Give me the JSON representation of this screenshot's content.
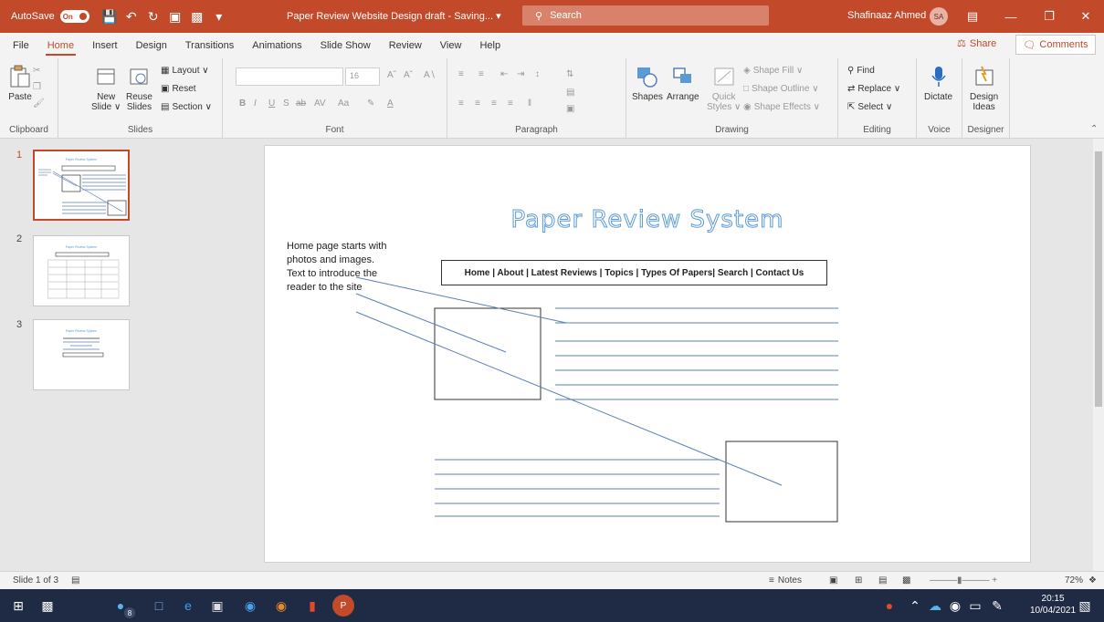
{
  "titlebar": {
    "autosave_label": "AutoSave",
    "autosave_state": "On",
    "document_title": "Paper Review Website Design draft - Saving... ▾",
    "search_placeholder": "Search",
    "user_name": "Shafinaaz Ahmed",
    "user_initials": "SA",
    "accent_color": "#c24a2b"
  },
  "tabs": [
    "File",
    "Home",
    "Insert",
    "Design",
    "Transitions",
    "Animations",
    "Slide Show",
    "Review",
    "View",
    "Help"
  ],
  "active_tab": "Home",
  "share_label": "Share",
  "comments_label": "Comments",
  "ribbon": {
    "clipboard": {
      "label": "Clipboard",
      "paste": "Paste"
    },
    "slides": {
      "label": "Slides",
      "new_slide": "New\nSlide ∨",
      "reuse_slides": "Reuse\nSlides",
      "layout": "Layout ∨",
      "reset": "Reset",
      "section": "Section ∨"
    },
    "font": {
      "label": "Font",
      "size": "16"
    },
    "paragraph": {
      "label": "Paragraph"
    },
    "drawing": {
      "label": "Drawing",
      "shapes": "Shapes",
      "arrange": "Arrange",
      "quick_styles": "Quick\nStyles ∨",
      "shape_fill": "Shape Fill ∨",
      "shape_outline": "Shape Outline ∨",
      "shape_effects": "Shape Effects ∨"
    },
    "editing": {
      "label": "Editing",
      "find": "Find",
      "replace": "Replace ∨",
      "select": "Select ∨"
    },
    "voice": {
      "label": "Voice",
      "dictate": "Dictate"
    },
    "designer": {
      "label": "Designer",
      "design_ideas": "Design\nIdeas"
    }
  },
  "thumbnails": [
    {
      "number": "1",
      "title": "Paper Review System"
    },
    {
      "number": "2",
      "title": "Paper Review System"
    },
    {
      "number": "3",
      "title": "Paper Review System"
    }
  ],
  "slide": {
    "title": "Paper Review System",
    "note_text": "Home page starts with photos and images. Text to introduce the reader to the site",
    "nav_text": "Home |  About |  Latest Reviews | Topics | Types Of Papers| Search |  Contact Us"
  },
  "status": {
    "slide_count": "Slide 1 of 3",
    "notes_label": "Notes",
    "zoom": "72%"
  },
  "taskbar": {
    "badge": "8",
    "time": "20:15",
    "date": "10/04/2021"
  }
}
